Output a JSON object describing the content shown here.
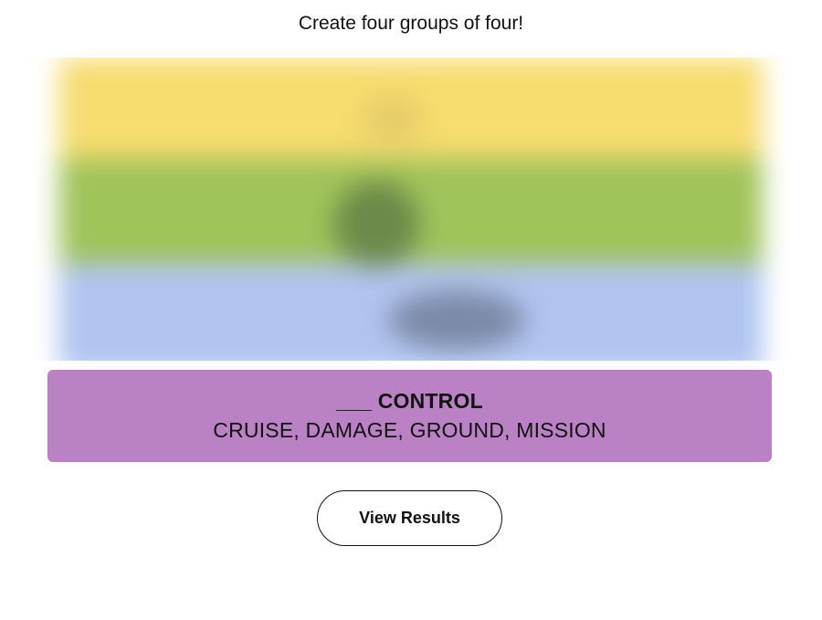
{
  "header": {
    "instructions": "Create four groups of four!"
  },
  "solved_group": {
    "title": "___ CONTROL",
    "members": "CRUISE, DAMAGE, GROUND, MISSION",
    "color": "#ba81c5"
  },
  "hidden_groups_colors": [
    "#f7dc6f",
    "#a0c35a",
    "#b0c4ef"
  ],
  "actions": {
    "view_results_label": "View Results"
  }
}
